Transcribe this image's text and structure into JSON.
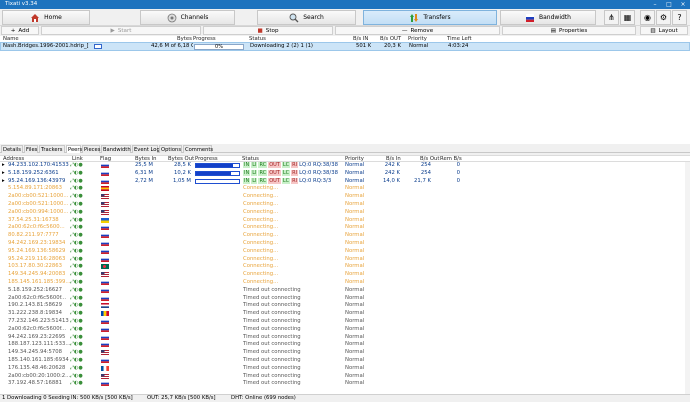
{
  "app": {
    "title": "Tixati v3.34"
  },
  "toolbar": {
    "tabs": [
      {
        "label": "Home",
        "icon": "home-icon"
      },
      {
        "label": "Channels",
        "icon": "channels-icon"
      },
      {
        "label": "Search",
        "icon": "search-icon"
      },
      {
        "label": "Transfers",
        "icon": "transfers-icon",
        "active": true
      },
      {
        "label": "Bandwidth",
        "icon": "bandwidth-icon"
      }
    ],
    "right_icons": [
      "network-icon",
      "stats-icon",
      "users-icon",
      "settings-icon",
      "help-icon"
    ]
  },
  "actions": {
    "add": "Add",
    "start": "Start",
    "stop": "Stop",
    "remove": "Remove",
    "properties": "Properties",
    "layout": "Layout"
  },
  "transfers": {
    "columns": [
      "Name",
      "Bytes",
      "Progress",
      "Status",
      "B/s IN",
      "B/s OUT",
      "Priority",
      "Time Left"
    ],
    "rows": [
      {
        "name": "Nash.Bridges.1996-2001.hdrip_[teko]",
        "bytes": "42,6 M of 6,18 G",
        "progress_text": "0%",
        "progress": 0.0,
        "status": "Downloading 2 (2) 1 (1)",
        "in": "501 K",
        "out": "20,3 K",
        "priority": "Normal",
        "time_left": "4:03:24"
      }
    ]
  },
  "detail_tabs": [
    "Details",
    "Files",
    "Trackers",
    "Peers",
    "Pieces",
    "Bandwidth",
    "Event Log",
    "Options",
    "Comments"
  ],
  "active_detail_tab": "Peers",
  "peers": {
    "columns": [
      "Address",
      "Link",
      "Flag",
      "Bytes In",
      "Bytes Out",
      "Progress",
      "Status",
      "Priority",
      "B/s In",
      "B/s Out",
      "Rem B/s"
    ],
    "rows": [
      {
        "address": "94.233.102.170:41533",
        "expand": true,
        "flag": "ru",
        "bytes_in": "25,5 M",
        "bytes_out": "28,5 K",
        "progress": 0.85,
        "status_segments": [
          "IN",
          "LI",
          "RC",
          "OUT",
          "LC",
          "RI"
        ],
        "status_tail": "LQ:0 RQ:38/38",
        "priority": "Normal",
        "bps_in": "242 K",
        "bps_out": "254",
        "rem": "0",
        "style": "active"
      },
      {
        "address": "5.18.159.252:6361",
        "expand": true,
        "flag": "ru",
        "bytes_in": "6,31 M",
        "bytes_out": "10,2 K",
        "progress": 0.82,
        "status_segments": [
          "IN",
          "LI",
          "RC",
          "OUT",
          "LC",
          "RI"
        ],
        "status_tail": "LQ:0 RQ:38/38",
        "priority": "Normal",
        "bps_in": "242 K",
        "bps_out": "254",
        "rem": "0",
        "style": "active"
      },
      {
        "address": "95.24.169.136:43979",
        "expand": true,
        "flag": "ru",
        "bytes_in": "2,72 M",
        "bytes_out": "1,05 M",
        "progress": 0.0,
        "status_segments": [
          "IN",
          "LI",
          "RC",
          "OUT",
          "LC",
          "RI"
        ],
        "status_tail": "LQ:0 RQ:3/3",
        "priority": "Normal",
        "bps_in": "14,0 K",
        "bps_out": "21,7 K",
        "rem": "0",
        "style": "active"
      },
      {
        "address": "5.154.89.171:20863",
        "flag": "es",
        "status": "Connecting...",
        "priority": "Normal",
        "style": "connecting"
      },
      {
        "address": "2a00:cb00:521:1000...",
        "flag": "us",
        "status": "Connecting...",
        "priority": "Normal",
        "style": "connecting"
      },
      {
        "address": "2a00:cb00:521:1000...",
        "flag": "us",
        "status": "Connecting...",
        "priority": "Normal",
        "style": "connecting"
      },
      {
        "address": "2a00:cb00:994:1000...",
        "flag": "us",
        "status": "Connecting...",
        "priority": "Normal",
        "style": "connecting"
      },
      {
        "address": "37.54.25.31:16738",
        "flag": "ua",
        "status": "Connecting...",
        "priority": "Normal",
        "style": "connecting"
      },
      {
        "address": "2a00:62c0:f6c5600...",
        "flag": "ru",
        "status": "Connecting...",
        "priority": "Normal",
        "style": "connecting"
      },
      {
        "address": "80.82.211.97:7777",
        "flag": "ru",
        "status": "Connecting...",
        "priority": "Normal",
        "style": "connecting"
      },
      {
        "address": "94.242.169.23:19834",
        "flag": "ru",
        "status": "Connecting...",
        "priority": "Normal",
        "style": "connecting"
      },
      {
        "address": "95.24.169.136:58629",
        "flag": "ru",
        "status": "Connecting...",
        "priority": "Normal",
        "style": "connecting"
      },
      {
        "address": "95.24.219.116:28063",
        "flag": "ru",
        "status": "Connecting...",
        "priority": "Normal",
        "style": "connecting"
      },
      {
        "address": "103.17.80.30:22863",
        "flag": "bd",
        "status": "Connecting...",
        "priority": "Normal",
        "style": "connecting"
      },
      {
        "address": "149.34.245.94:20083",
        "flag": "us",
        "status": "Connecting...",
        "priority": "Normal",
        "style": "connecting"
      },
      {
        "address": "185.145.161.185:399...",
        "flag": "ru",
        "status": "Connecting...",
        "priority": "Normal",
        "style": "connecting"
      },
      {
        "address": "5.18.159.252:16627",
        "flag": "ru",
        "status": "Timed out connecting",
        "priority": "Normal",
        "style": "timeout"
      },
      {
        "address": "2a00:62c0:f6c5600f...",
        "flag": "ru",
        "status": "Timed out connecting",
        "priority": "Normal",
        "style": "timeout"
      },
      {
        "address": "190.2.143.81:58629",
        "flag": "nl",
        "status": "Timed out connecting",
        "priority": "Normal",
        "style": "timeout"
      },
      {
        "address": "31.222.238.8:19834",
        "flag": "md",
        "status": "Timed out connecting",
        "priority": "Normal",
        "style": "timeout"
      },
      {
        "address": "77.232.146.223:51413",
        "flag": "ru",
        "status": "Timed out connecting",
        "priority": "Normal",
        "style": "timeout"
      },
      {
        "address": "2a00:62c0:f6c5600f...",
        "flag": "ru",
        "status": "Timed out connecting",
        "priority": "Normal",
        "style": "timeout"
      },
      {
        "address": "94.242.169.23:22695",
        "flag": "ru",
        "status": "Timed out connecting",
        "priority": "Normal",
        "style": "timeout"
      },
      {
        "address": "188.187.123.111:533...",
        "flag": "ru",
        "status": "Timed out connecting",
        "priority": "Normal",
        "style": "timeout"
      },
      {
        "address": "149.34.245.94:5708",
        "flag": "us",
        "status": "Timed out connecting",
        "priority": "Normal",
        "style": "timeout"
      },
      {
        "address": "185.140.161.185:6934",
        "flag": "ru",
        "status": "Timed out connecting",
        "priority": "Normal",
        "style": "timeout"
      },
      {
        "address": "176.135.48.46:20628",
        "flag": "fr",
        "status": "Timed out connecting",
        "priority": "Normal",
        "style": "timeout"
      },
      {
        "address": "2a00:cb00:20:1000:2...",
        "flag": "us",
        "status": "Timed out connecting",
        "priority": "Normal",
        "style": "timeout"
      },
      {
        "address": "37.192.48.57:16881",
        "flag": "ru",
        "status": "Timed out connecting",
        "priority": "Normal",
        "style": "timeout"
      }
    ]
  },
  "statusbar": {
    "counts": "1 Downloading  0 Seeding",
    "in": "IN: 500 KB/s [500 KB/s]",
    "out": "OUT: 25,7 KB/s [500 KB/s]",
    "dht": "DHT: Online (699 nodes)"
  },
  "colors": {
    "accent": "#1e73be",
    "connecting": "#e8a33a",
    "timeout": "#555555",
    "active": "#0a3c8c",
    "selected_row": "#cce4f7"
  }
}
